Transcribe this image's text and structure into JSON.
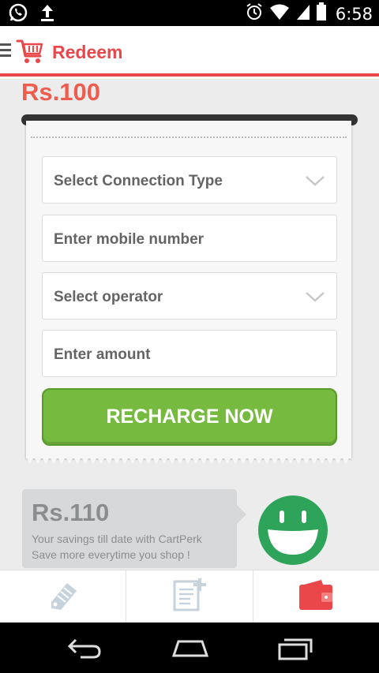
{
  "status_bar": {
    "time": "6:58",
    "left_icons": [
      "whatsapp-icon",
      "upload-icon"
    ],
    "right_icons": [
      "alarm-icon",
      "wifi-icon",
      "signal-icon",
      "battery-icon"
    ]
  },
  "action_bar": {
    "title": "Redeem",
    "icons": [
      "menu-icon",
      "cart-icon"
    ]
  },
  "amount_heading": "Rs.100",
  "form": {
    "connection_type_placeholder": "Select Connection Type",
    "mobile_placeholder": "Enter mobile number",
    "operator_placeholder": "Select operator",
    "amount_placeholder": "Enter amount",
    "submit_label": "RECHARGE NOW"
  },
  "savings": {
    "amount": "Rs.110",
    "line1": "Your savings till date with CartPerk",
    "line2": "Save more everytime you shop !"
  },
  "bottom_tabs": [
    {
      "icon": "tag-icon"
    },
    {
      "icon": "add-list-icon"
    },
    {
      "icon": "wallet-icon",
      "active": true
    }
  ],
  "colors": {
    "accent": "#e9474a",
    "amount": "#ef5b4c",
    "button": "#76bb40",
    "smiley": "#2ea45a"
  }
}
